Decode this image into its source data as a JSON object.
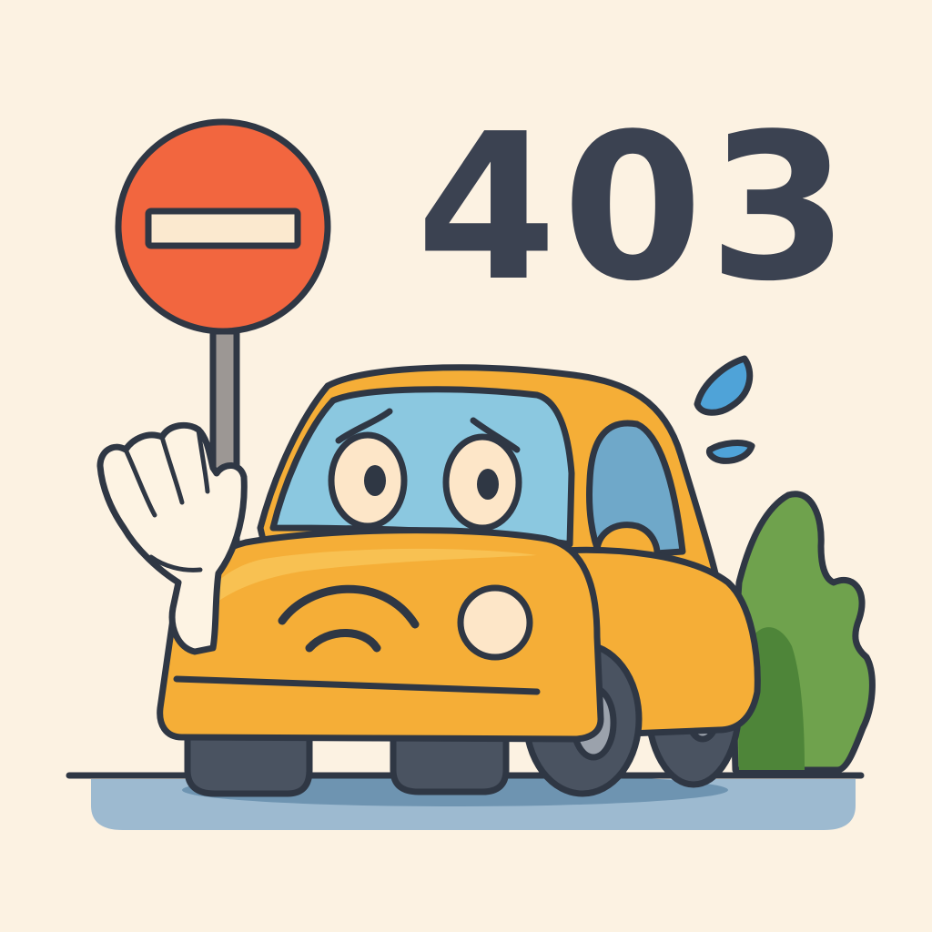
{
  "error": {
    "code": "403"
  },
  "colors": {
    "background": "#FCF2E2",
    "outline": "#2F3744",
    "code_text": "#3B4251",
    "sign_red": "#F2663F",
    "sign_bar": "#FBE9CF",
    "pole": "#9C9794",
    "car_body": "#F5AE37",
    "car_body_light": "#F8C152",
    "windshield": "#8BC8E0",
    "side_window": "#6FA8C9",
    "eye_white": "#FDE6C8",
    "hand": "#FDF3E3",
    "tire": "#4A5361",
    "hubcap": "#9BA2AC",
    "bush_light": "#6FA24D",
    "bush_dark": "#4E8539",
    "road_shadow": "#6E94B1",
    "road_shadow_light": "#9DBAD0",
    "sweat_drop": "#4FA3D8"
  },
  "icons": {
    "sign": "no-entry-sign-icon",
    "hand": "stop-hand-icon",
    "car": "worried-car-icon",
    "sweat": "sweat-drop-icon",
    "bush": "bush-icon"
  }
}
